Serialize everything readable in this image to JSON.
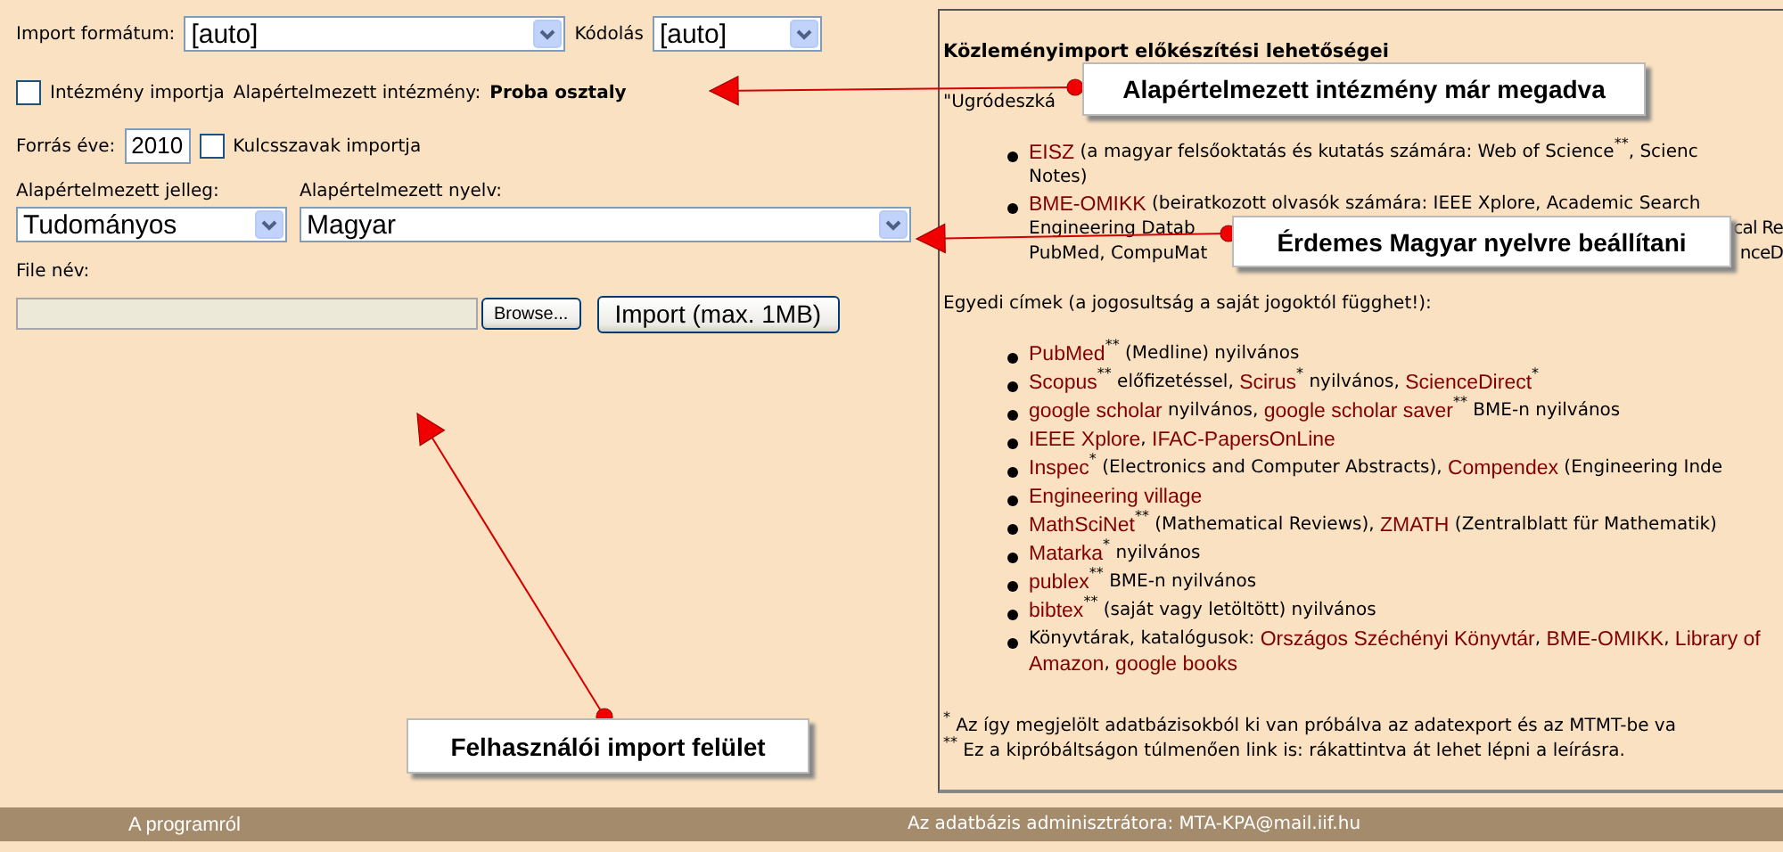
{
  "form": {
    "import_format": {
      "label": "Import formátum:",
      "value": "[auto]"
    },
    "encoding": {
      "label": "Kódolás",
      "value": "[auto]"
    },
    "institution_import": {
      "label": "Intézmény importja",
      "checked": false
    },
    "default_institution": {
      "label": "Alapértelmezett intézmény:",
      "value": "Proba osztaly"
    },
    "source_year": {
      "label": "Forrás éve:",
      "value": "2010"
    },
    "keywords_import": {
      "label": "Kulcsszavak importja",
      "checked": false
    },
    "default_type": {
      "label": "Alapértelmezett jelleg:",
      "value": "Tudományos"
    },
    "default_language": {
      "label": "Alapértelmezett nyelv:",
      "value": "Magyar"
    },
    "file_name": {
      "label": "File név:"
    },
    "browse_button": "Browse...",
    "import_button": "Import (max. 1MB)"
  },
  "info_panel": {
    "title": "Közleményimport előkészítési lehetőségei",
    "intro": "\"Ugródeszká",
    "list_1": [
      {
        "lines": [
          {
            "segments": [
              {
                "kind": "link",
                "text": "EISZ"
              },
              {
                "kind": "text",
                "text": " (a magyar felsőoktatás és kutatás számára: Web of Science"
              },
              {
                "kind": "mark",
                "text": "**"
              },
              {
                "kind": "text",
                "text": ", Scienc"
              }
            ]
          },
          {
            "segments": [
              {
                "kind": "text",
                "text": "Notes)"
              }
            ]
          }
        ]
      },
      {
        "lines": [
          {
            "segments": [
              {
                "kind": "link",
                "text": "BME-OMIKK"
              },
              {
                "kind": "text",
                "text": " (beiratkozott olvasók számára: IEEE Xplore, Academic Search"
              }
            ]
          },
          {
            "segments": [
              {
                "kind": "text",
                "text": "Engineering Datab"
              }
            ],
            "tail": "cal Re"
          },
          {
            "segments": [
              {
                "kind": "text",
                "text": "PubMed, CompuMat"
              }
            ],
            "tail": "nceD"
          }
        ]
      }
    ],
    "subheading": "Egyedi címek (a jogosultság a saját jogoktól függhet!):",
    "list_2": [
      {
        "lines": [
          {
            "segments": [
              {
                "kind": "link",
                "text": "PubMed"
              },
              {
                "kind": "mark",
                "text": "**"
              },
              {
                "kind": "text",
                "text": " (Medline) nyilvános"
              }
            ]
          }
        ]
      },
      {
        "lines": [
          {
            "segments": [
              {
                "kind": "link",
                "text": "Scopus"
              },
              {
                "kind": "mark",
                "text": "**"
              },
              {
                "kind": "text",
                "text": " előfizetéssel, "
              },
              {
                "kind": "link",
                "text": "Scirus"
              },
              {
                "kind": "mark",
                "text": "*"
              },
              {
                "kind": "text",
                "text": " nyilvános, "
              },
              {
                "kind": "link",
                "text": "ScienceDirect"
              },
              {
                "kind": "mark",
                "text": "*"
              }
            ]
          }
        ]
      },
      {
        "lines": [
          {
            "segments": [
              {
                "kind": "link",
                "text": "google scholar"
              },
              {
                "kind": "text",
                "text": " nyilvános, "
              },
              {
                "kind": "link",
                "text": "google scholar saver"
              },
              {
                "kind": "mark",
                "text": "**"
              },
              {
                "kind": "text",
                "text": " BME-n nyilvános"
              }
            ]
          }
        ]
      },
      {
        "lines": [
          {
            "segments": [
              {
                "kind": "link",
                "text": "IEEE Xplore"
              },
              {
                "kind": "text",
                "text": ", "
              },
              {
                "kind": "link",
                "text": "IFAC-PapersOnLine"
              }
            ]
          }
        ]
      },
      {
        "lines": [
          {
            "segments": [
              {
                "kind": "link",
                "text": "Inspec"
              },
              {
                "kind": "mark",
                "text": "*"
              },
              {
                "kind": "text",
                "text": " (Electronics and Computer Abstracts), "
              },
              {
                "kind": "link",
                "text": "Compendex"
              },
              {
                "kind": "text",
                "text": " (Engineering Inde"
              }
            ]
          }
        ]
      },
      {
        "lines": [
          {
            "segments": [
              {
                "kind": "link",
                "text": "Engineering village"
              }
            ]
          }
        ]
      },
      {
        "lines": [
          {
            "segments": [
              {
                "kind": "link",
                "text": "MathSciNet"
              },
              {
                "kind": "mark",
                "text": "**"
              },
              {
                "kind": "text",
                "text": " (Mathematical Reviews), "
              },
              {
                "kind": "link",
                "text": "ZMATH"
              },
              {
                "kind": "text",
                "text": " (Zentralblatt für Mathematik)"
              }
            ]
          }
        ]
      },
      {
        "lines": [
          {
            "segments": [
              {
                "kind": "link",
                "text": "Matarka"
              },
              {
                "kind": "mark",
                "text": "*"
              },
              {
                "kind": "text",
                "text": " nyilvános"
              }
            ]
          }
        ]
      },
      {
        "lines": [
          {
            "segments": [
              {
                "kind": "link",
                "text": "publex"
              },
              {
                "kind": "mark",
                "text": "**"
              },
              {
                "kind": "text",
                "text": " BME-n nyilvános"
              }
            ]
          }
        ]
      },
      {
        "lines": [
          {
            "segments": [
              {
                "kind": "link",
                "text": "bibtex"
              },
              {
                "kind": "mark",
                "text": "**"
              },
              {
                "kind": "text",
                "text": " (saját vagy letöltött) nyilvános"
              }
            ]
          }
        ]
      },
      {
        "lines": [
          {
            "segments": [
              {
                "kind": "text",
                "text": "Könyvtárak, katalógusok: "
              },
              {
                "kind": "link",
                "text": "Országos Széchényi Könyvtár"
              },
              {
                "kind": "text",
                "text": ", "
              },
              {
                "kind": "link",
                "text": "BME-OMIKK"
              },
              {
                "kind": "text",
                "text": ", "
              },
              {
                "kind": "link",
                "text": "Library of"
              }
            ]
          },
          {
            "segments": [
              {
                "kind": "link",
                "text": "Amazon"
              },
              {
                "kind": "text",
                "text": ", "
              },
              {
                "kind": "link",
                "text": "google books"
              }
            ]
          }
        ]
      }
    ],
    "footnotes": [
      {
        "mark": "*",
        "text": " Az így megjelölt adatbázisokból ki van próbálva az adatexport és az MTMT-be va"
      },
      {
        "mark": "**",
        "text": " Ez a kipróbáltságon túlmenően link is: rákattintva át lehet lépni a leírásra."
      }
    ]
  },
  "callouts": [
    {
      "text": "Alapértelmezett intézmény már megadva"
    },
    {
      "text": "Érdemes Magyar nyelvre beállítani"
    },
    {
      "text": "Felhasználói import felület"
    }
  ],
  "footer": {
    "about": "A programról",
    "admin": "Az adatbázis adminisztrátora: MTA-KPA@mail.iif.hu"
  }
}
